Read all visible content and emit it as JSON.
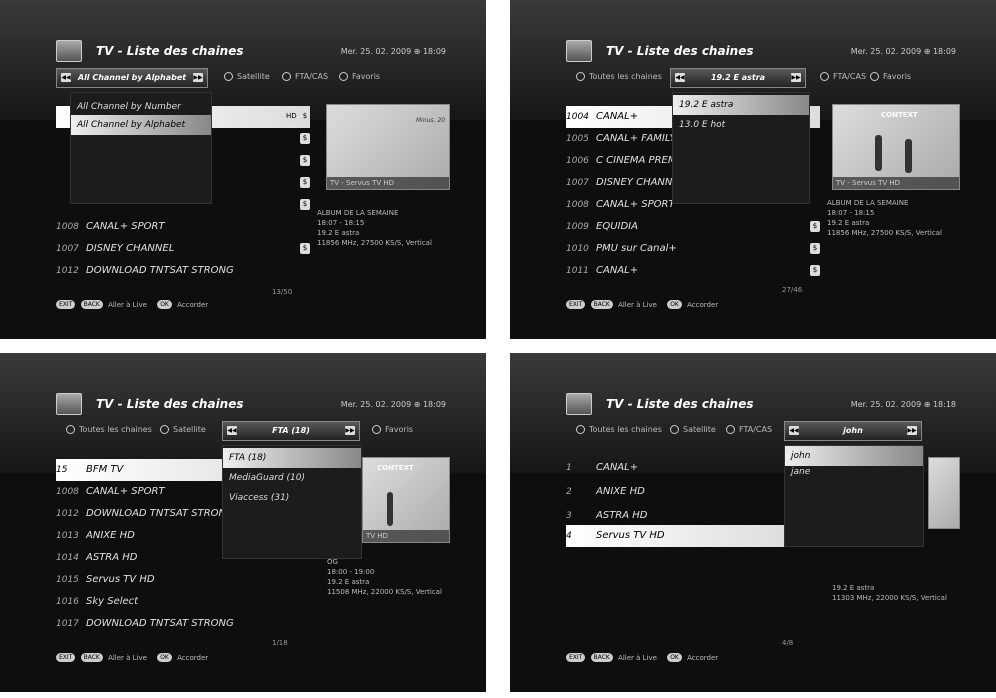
{
  "common": {
    "title": "TV - Liste des chaines",
    "footer": {
      "exit": "EXIT",
      "back": "BACK",
      "ok": "OK",
      "live": "Aller à Live",
      "tune": "Accorder"
    }
  },
  "p1": {
    "datetime": "Mer. 25. 02. 2009  ⊕  18:09",
    "selector": "All Channel by Alphabet",
    "tab_sat": "Satellite",
    "tab_fta": "FTA/CAS",
    "tab_fav": "Favoris",
    "dropdown": [
      "All Channel by Number",
      "All Channel by Alphabet"
    ],
    "rows": [
      {
        "num": "1008",
        "name": "CANAL+ SPORT"
      },
      {
        "num": "1007",
        "name": "DISNEY CHANNEL"
      },
      {
        "num": "1012",
        "name": "DOWNLOAD TNTSAT STRONG"
      }
    ],
    "info": "ALBUM DE LA SEMAINE\n18:07 - 18:15\n19.2 E astra\n11856 MHz, 27500 KS/S, Vertical",
    "preview_caption": "TV - Servus TV HD",
    "preview_text": "Minus, 20",
    "pager": "13/50"
  },
  "p2": {
    "datetime": "Mer. 25. 02. 2009  ⊕  18:09",
    "tab_all": "Toutes les chaines",
    "selector": "19.2 E astra",
    "tab_fta": "FTA/CAS",
    "tab_fav": "Favoris",
    "dropdown": [
      "19.2 E astra",
      "13.0 E hot"
    ],
    "rows": [
      {
        "num": "1004",
        "name": "CANAL+"
      },
      {
        "num": "1005",
        "name": "CANAL+ FAMILY"
      },
      {
        "num": "1006",
        "name": "C CINEMA PREM"
      },
      {
        "num": "1007",
        "name": "DISNEY CHANNE"
      },
      {
        "num": "1008",
        "name": "CANAL+ SPORT"
      },
      {
        "num": "1009",
        "name": "EQUIDIA"
      },
      {
        "num": "1010",
        "name": "PMU sur Canal+"
      },
      {
        "num": "1011",
        "name": "CANAL+"
      }
    ],
    "info": "ALBUM DE LA SEMAINE\n18:07 - 18:15\n19.2 E astra\n11856 MHz, 27500 KS/S, Vertical",
    "preview_caption": "TV - Servus TV HD",
    "preview_text": "CONTEXT",
    "pager": "27/46"
  },
  "p3": {
    "datetime": "Mer. 25. 02. 2009  ⊕  18:09",
    "tab_all": "Toutes les chaines",
    "tab_sat": "Satellite",
    "selector": "FTA (18)",
    "tab_fav": "Favoris",
    "dropdown": [
      "FTA (18)",
      "MediaGuard (10)",
      "Viaccess (31)"
    ],
    "rows": [
      {
        "num": "15",
        "name": "BFM TV"
      },
      {
        "num": "1008",
        "name": "CANAL+ SPORT"
      },
      {
        "num": "1012",
        "name": "DOWNLOAD TNTSAT STRONG"
      },
      {
        "num": "1013",
        "name": "ANIXE HD"
      },
      {
        "num": "1014",
        "name": "ASTRA HD"
      },
      {
        "num": "1015",
        "name": "Servus TV HD"
      },
      {
        "num": "1016",
        "name": "Sky Select"
      },
      {
        "num": "1017",
        "name": "DOWNLOAD TNTSAT STRONG"
      }
    ],
    "info": "OG\n18:00 - 19:00\n19.2 E astra\n11508 MHz, 22000 KS/S, Vertical",
    "preview_caption": "TV HD",
    "preview_text": "CONTEXT",
    "pager": "1/18"
  },
  "p4": {
    "datetime": "Mer. 25. 02. 2009  ⊕  18:18",
    "tab_all": "Toutes les chaines",
    "tab_sat": "Satellite",
    "tab_fta": "FTA/CAS",
    "selector": "john",
    "dropdown": [
      "john",
      "jane"
    ],
    "rows": [
      {
        "num": "1",
        "name": "CANAL+"
      },
      {
        "num": "2",
        "name": "ANIXE HD"
      },
      {
        "num": "3",
        "name": "ASTRA HD"
      },
      {
        "num": "4",
        "name": "Servus TV HD"
      }
    ],
    "info": "19.2 E astra\n11303 MHz, 22000 KS/S, Vertical",
    "pager": "4/8"
  }
}
